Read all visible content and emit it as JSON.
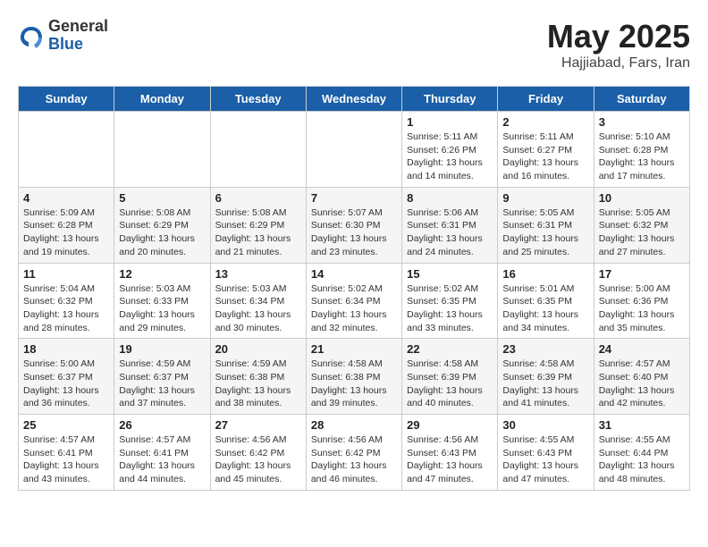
{
  "logo": {
    "general": "General",
    "blue": "Blue"
  },
  "title": "May 2025",
  "location": "Hajjiabad, Fars, Iran",
  "days_of_week": [
    "Sunday",
    "Monday",
    "Tuesday",
    "Wednesday",
    "Thursday",
    "Friday",
    "Saturday"
  ],
  "weeks": [
    [
      {
        "day": "",
        "info": ""
      },
      {
        "day": "",
        "info": ""
      },
      {
        "day": "",
        "info": ""
      },
      {
        "day": "",
        "info": ""
      },
      {
        "day": "1",
        "info": "Sunrise: 5:11 AM\nSunset: 6:26 PM\nDaylight: 13 hours and 14 minutes."
      },
      {
        "day": "2",
        "info": "Sunrise: 5:11 AM\nSunset: 6:27 PM\nDaylight: 13 hours and 16 minutes."
      },
      {
        "day": "3",
        "info": "Sunrise: 5:10 AM\nSunset: 6:28 PM\nDaylight: 13 hours and 17 minutes."
      }
    ],
    [
      {
        "day": "4",
        "info": "Sunrise: 5:09 AM\nSunset: 6:28 PM\nDaylight: 13 hours and 19 minutes."
      },
      {
        "day": "5",
        "info": "Sunrise: 5:08 AM\nSunset: 6:29 PM\nDaylight: 13 hours and 20 minutes."
      },
      {
        "day": "6",
        "info": "Sunrise: 5:08 AM\nSunset: 6:29 PM\nDaylight: 13 hours and 21 minutes."
      },
      {
        "day": "7",
        "info": "Sunrise: 5:07 AM\nSunset: 6:30 PM\nDaylight: 13 hours and 23 minutes."
      },
      {
        "day": "8",
        "info": "Sunrise: 5:06 AM\nSunset: 6:31 PM\nDaylight: 13 hours and 24 minutes."
      },
      {
        "day": "9",
        "info": "Sunrise: 5:05 AM\nSunset: 6:31 PM\nDaylight: 13 hours and 25 minutes."
      },
      {
        "day": "10",
        "info": "Sunrise: 5:05 AM\nSunset: 6:32 PM\nDaylight: 13 hours and 27 minutes."
      }
    ],
    [
      {
        "day": "11",
        "info": "Sunrise: 5:04 AM\nSunset: 6:32 PM\nDaylight: 13 hours and 28 minutes."
      },
      {
        "day": "12",
        "info": "Sunrise: 5:03 AM\nSunset: 6:33 PM\nDaylight: 13 hours and 29 minutes."
      },
      {
        "day": "13",
        "info": "Sunrise: 5:03 AM\nSunset: 6:34 PM\nDaylight: 13 hours and 30 minutes."
      },
      {
        "day": "14",
        "info": "Sunrise: 5:02 AM\nSunset: 6:34 PM\nDaylight: 13 hours and 32 minutes."
      },
      {
        "day": "15",
        "info": "Sunrise: 5:02 AM\nSunset: 6:35 PM\nDaylight: 13 hours and 33 minutes."
      },
      {
        "day": "16",
        "info": "Sunrise: 5:01 AM\nSunset: 6:35 PM\nDaylight: 13 hours and 34 minutes."
      },
      {
        "day": "17",
        "info": "Sunrise: 5:00 AM\nSunset: 6:36 PM\nDaylight: 13 hours and 35 minutes."
      }
    ],
    [
      {
        "day": "18",
        "info": "Sunrise: 5:00 AM\nSunset: 6:37 PM\nDaylight: 13 hours and 36 minutes."
      },
      {
        "day": "19",
        "info": "Sunrise: 4:59 AM\nSunset: 6:37 PM\nDaylight: 13 hours and 37 minutes."
      },
      {
        "day": "20",
        "info": "Sunrise: 4:59 AM\nSunset: 6:38 PM\nDaylight: 13 hours and 38 minutes."
      },
      {
        "day": "21",
        "info": "Sunrise: 4:58 AM\nSunset: 6:38 PM\nDaylight: 13 hours and 39 minutes."
      },
      {
        "day": "22",
        "info": "Sunrise: 4:58 AM\nSunset: 6:39 PM\nDaylight: 13 hours and 40 minutes."
      },
      {
        "day": "23",
        "info": "Sunrise: 4:58 AM\nSunset: 6:39 PM\nDaylight: 13 hours and 41 minutes."
      },
      {
        "day": "24",
        "info": "Sunrise: 4:57 AM\nSunset: 6:40 PM\nDaylight: 13 hours and 42 minutes."
      }
    ],
    [
      {
        "day": "25",
        "info": "Sunrise: 4:57 AM\nSunset: 6:41 PM\nDaylight: 13 hours and 43 minutes."
      },
      {
        "day": "26",
        "info": "Sunrise: 4:57 AM\nSunset: 6:41 PM\nDaylight: 13 hours and 44 minutes."
      },
      {
        "day": "27",
        "info": "Sunrise: 4:56 AM\nSunset: 6:42 PM\nDaylight: 13 hours and 45 minutes."
      },
      {
        "day": "28",
        "info": "Sunrise: 4:56 AM\nSunset: 6:42 PM\nDaylight: 13 hours and 46 minutes."
      },
      {
        "day": "29",
        "info": "Sunrise: 4:56 AM\nSunset: 6:43 PM\nDaylight: 13 hours and 47 minutes."
      },
      {
        "day": "30",
        "info": "Sunrise: 4:55 AM\nSunset: 6:43 PM\nDaylight: 13 hours and 47 minutes."
      },
      {
        "day": "31",
        "info": "Sunrise: 4:55 AM\nSunset: 6:44 PM\nDaylight: 13 hours and 48 minutes."
      }
    ]
  ]
}
